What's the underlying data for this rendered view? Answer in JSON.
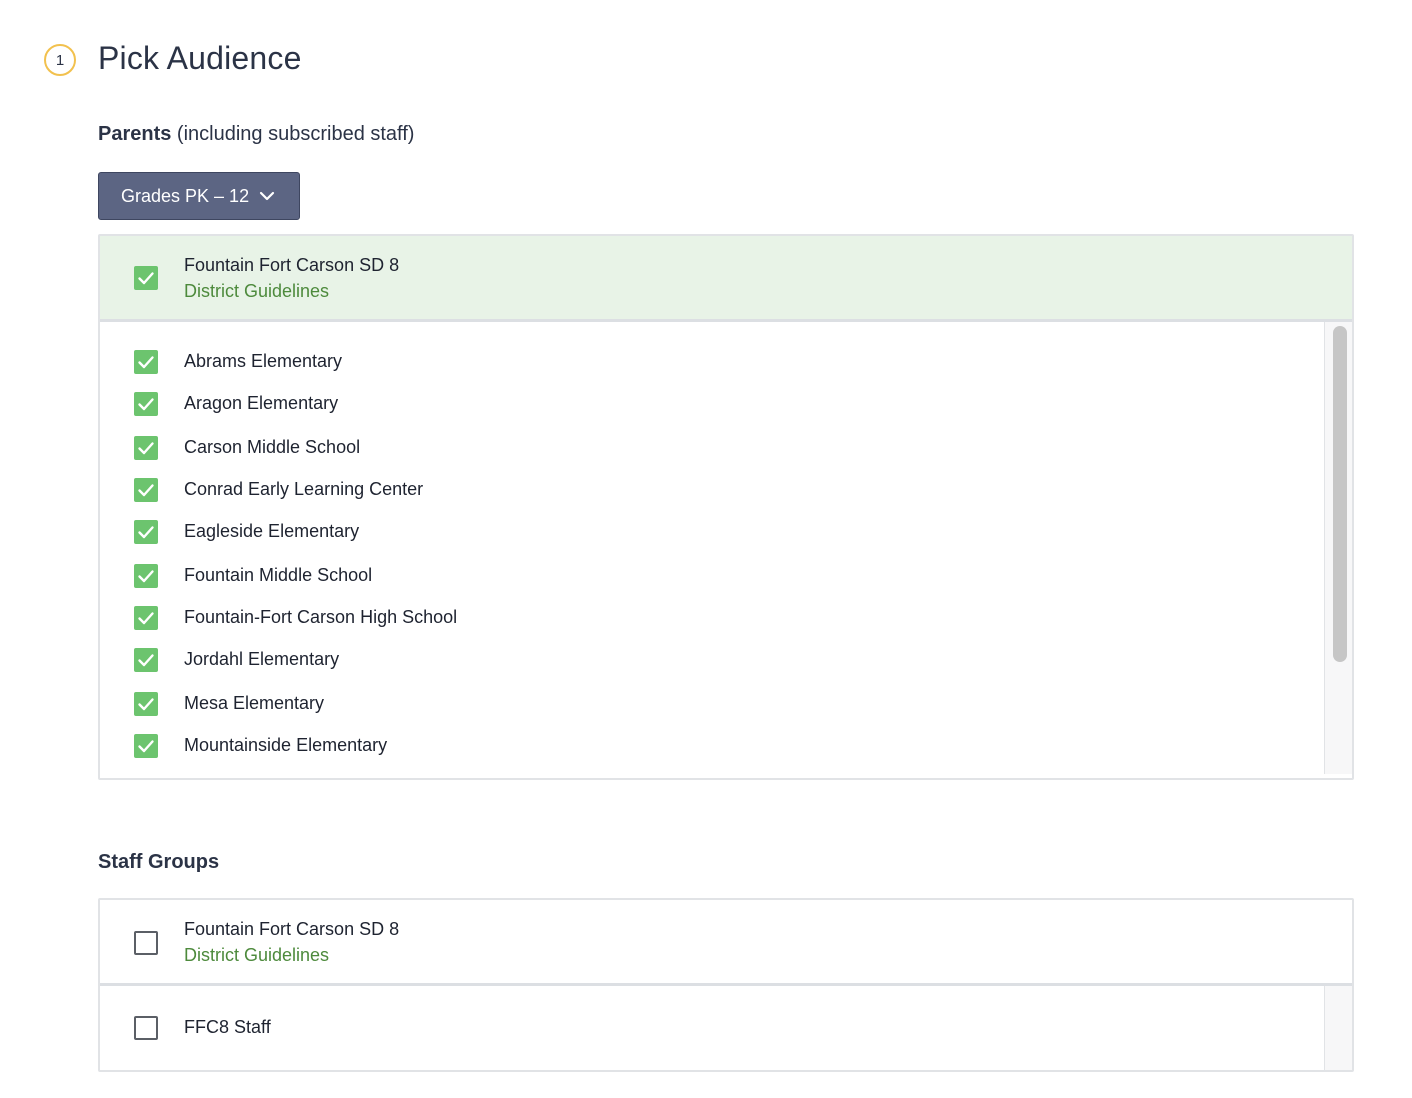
{
  "step": {
    "number": "1",
    "title": "Pick Audience"
  },
  "parents": {
    "label_bold": "Parents",
    "label_rest": " (including subscribed staff)",
    "grades_button": "Grades PK – 12",
    "district": {
      "name": "Fountain Fort Carson SD 8",
      "link": "District Guidelines",
      "checked": true
    },
    "schools": [
      {
        "name": "Abrams Elementary",
        "checked": true
      },
      {
        "name": "Aragon Elementary",
        "checked": true
      },
      {
        "name": "Carson Middle School",
        "checked": true
      },
      {
        "name": "Conrad Early Learning Center",
        "checked": true
      },
      {
        "name": "Eagleside Elementary",
        "checked": true
      },
      {
        "name": "Fountain Middle School",
        "checked": true
      },
      {
        "name": "Fountain-Fort Carson High School",
        "checked": true
      },
      {
        "name": "Jordahl Elementary",
        "checked": true
      },
      {
        "name": "Mesa Elementary",
        "checked": true
      },
      {
        "name": "Mountainside Elementary",
        "checked": true
      }
    ]
  },
  "staff_groups": {
    "label": "Staff Groups",
    "district": {
      "name": "Fountain Fort Carson SD 8",
      "link": "District Guidelines",
      "checked": false
    },
    "groups": [
      {
        "name": "FFC8 Staff",
        "checked": false
      }
    ]
  },
  "icons": {
    "chevron": "chevron-down-icon",
    "check": "checkmark-icon"
  },
  "colors": {
    "accent_green": "#6cc46e",
    "link_green": "#4d8a3c",
    "button_bg": "#5c6583",
    "step_ring": "#f2c14e"
  }
}
